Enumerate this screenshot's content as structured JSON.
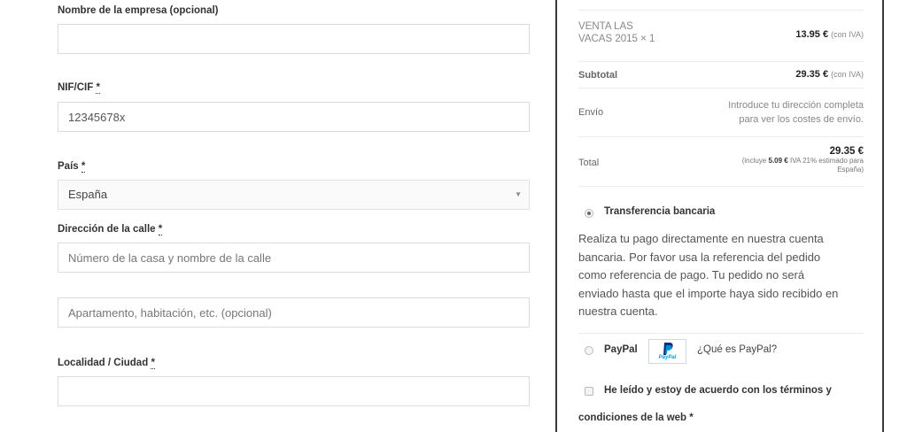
{
  "billing_form": {
    "company": {
      "label": "Nombre de la empresa (opcional)",
      "value": ""
    },
    "nif": {
      "label": "NIF/CIF",
      "required_mark": "*",
      "value": "12345678x"
    },
    "country": {
      "label": "País",
      "required_mark": "*",
      "selected": "España"
    },
    "street": {
      "label": "Dirección de la calle",
      "required_mark": "*",
      "line1_placeholder": "Número de la casa y nombre de la calle",
      "line2_placeholder": "Apartamento, habitación, etc. (opcional)"
    },
    "city": {
      "label": "Localidad / Ciudad",
      "required_mark": "*",
      "value": ""
    }
  },
  "order_review": {
    "item": {
      "name_line1": "VENTA LAS",
      "name_line2": "VACAS 2015",
      "qty": "× 1",
      "price": "13.95 €",
      "tax_note": "(con IVA)"
    },
    "subtotal": {
      "label": "Subtotal",
      "amount": "29.35 €",
      "tax_note": "(con IVA)"
    },
    "shipping": {
      "label": "Envío",
      "line1": "Introduce tu dirección completa",
      "line2": "para ver los costes de envío."
    },
    "total": {
      "label": "Total",
      "amount": "29.35 €",
      "note_prefix": "(incluye",
      "note_tax_amount": "5.09 €",
      "note_suffix": "IVA 21% estimado para",
      "note_line2": "España)"
    }
  },
  "payment": {
    "bank_transfer": {
      "label": "Transferencia bancaria",
      "selected": true,
      "description": [
        "Realiza tu pago directamente en nuestra cuenta",
        "bancaria. Por favor usa la referencia del pedido",
        "como referencia de pago. Tu pedido no será",
        "enviado hasta que el importe haya sido recibido en",
        "nuestra cuenta."
      ]
    },
    "paypal": {
      "label": "PayPal",
      "logo_text": "PayPal",
      "link": "¿Qué es PayPal?",
      "selected": false
    },
    "terms": {
      "line1": "He leído y estoy de acuerdo con los términos y",
      "line2": "condiciones de la web *",
      "checked": false
    }
  },
  "colors": {
    "paypal_blue": "#003087",
    "paypal_light": "#009cde",
    "panel_border": "#3a3a3a"
  }
}
